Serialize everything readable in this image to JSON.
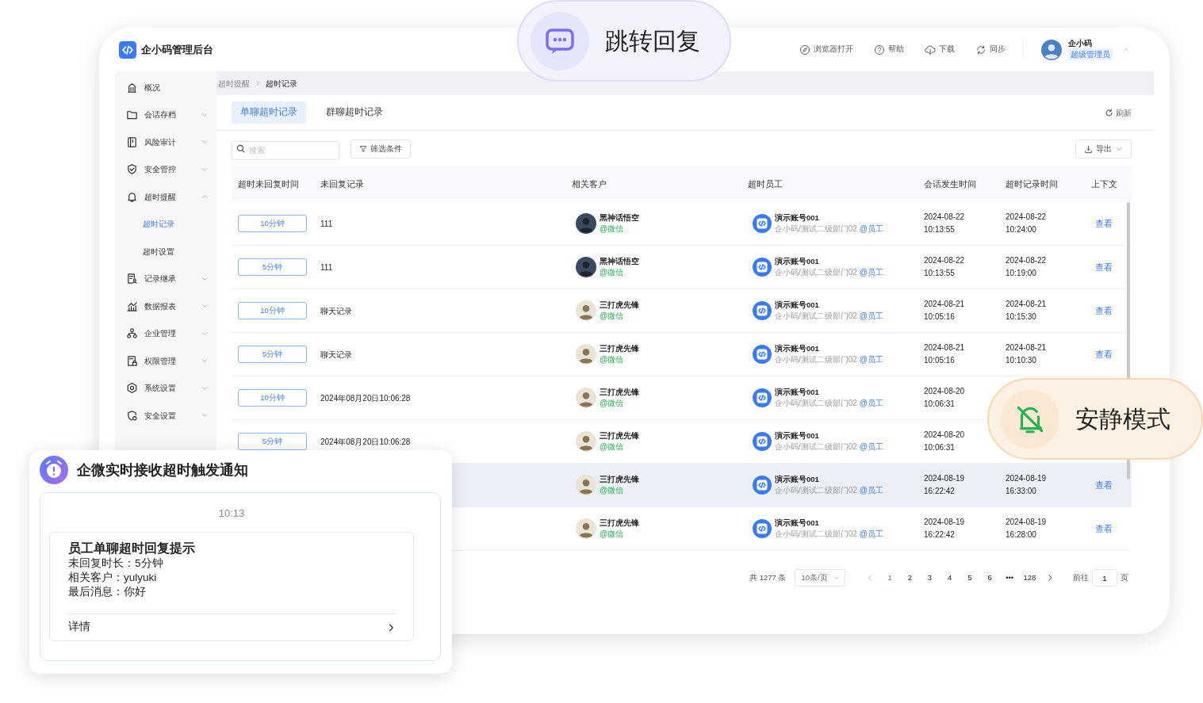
{
  "callouts": [
    {
      "kind": "jump",
      "label": "跳转回复"
    },
    {
      "kind": "quiet",
      "label": "安静模式"
    }
  ],
  "app": {
    "title": "企小码管理后台",
    "toolbar": [
      {
        "label": "浏览器打开"
      },
      {
        "label": "帮助"
      },
      {
        "label": "下载"
      },
      {
        "label": "同步"
      }
    ],
    "user": {
      "name": "企小码",
      "role": "超级管理员"
    }
  },
  "sidebar": {
    "items": [
      {
        "label": "概况",
        "selected": false
      },
      {
        "label": "会话存档",
        "expanded": false,
        "selected": false
      },
      {
        "label": "风险审计",
        "expanded": false,
        "selected": false
      },
      {
        "label": "安全管控",
        "expanded": false,
        "selected": false
      },
      {
        "label": "超时提醒",
        "expanded": true,
        "selected": false,
        "children": [
          {
            "label": "超时记录",
            "selected": true
          },
          {
            "label": "超时设置",
            "selected": false
          }
        ]
      },
      {
        "label": "记录继承",
        "expanded": false,
        "selected": false
      },
      {
        "label": "数据报表",
        "expanded": false,
        "selected": false
      },
      {
        "label": "企业管理",
        "expanded": false,
        "selected": false
      },
      {
        "label": "权限管理",
        "expanded": false,
        "selected": false
      },
      {
        "label": "系统设置",
        "expanded": false,
        "selected": false
      },
      {
        "label": "安全设置",
        "expanded": false,
        "selected": false
      }
    ]
  },
  "breadcrumbs": [
    "超时提醒",
    "超时记录"
  ],
  "tabs": [
    {
      "label": "单聊超时记录",
      "selected": true
    },
    {
      "label": "群聊超时记录",
      "selected": false
    }
  ],
  "refresh": "刷新",
  "search": {
    "placeholder": "搜索"
  },
  "filter": "筛选条件",
  "export": "导出",
  "table": {
    "columns": [
      "超时未回复时间",
      "未回复记录",
      "相关客户",
      "超时员工",
      "会话发生时间",
      "超时记录时间",
      "上下文"
    ],
    "rows": [
      {
        "timeout": "10分钟",
        "record": "111",
        "customer": "黑神话悟空",
        "customer_source": "@微信",
        "employee": "演示账号001",
        "dept": "企小码/测试二级部门02",
        "employee_tag": "@员工",
        "session_date": "2024-08-22",
        "session_time": "10:13:55",
        "record_date": "2024-08-22",
        "record_time": "10:24:00",
        "action": "查看",
        "highlighted": false
      },
      {
        "timeout": "5分钟",
        "record": "111",
        "customer": "黑神话悟空",
        "customer_source": "@微信",
        "employee": "演示账号001",
        "dept": "企小码/测试二级部门02",
        "employee_tag": "@员工",
        "session_date": "2024-08-22",
        "session_time": "10:13:55",
        "record_date": "2024-08-22",
        "record_time": "10:19:00",
        "action": "查看",
        "highlighted": false
      },
      {
        "timeout": "10分钟",
        "record": "聊天记录",
        "customer": "三打虎先锋",
        "customer_source": "@微信",
        "employee": "演示账号001",
        "dept": "企小码/测试二级部门02",
        "employee_tag": "@员工",
        "session_date": "2024-08-21",
        "session_time": "10:05:16",
        "record_date": "2024-08-21",
        "record_time": "10:15:30",
        "action": "查看",
        "highlighted": false
      },
      {
        "timeout": "5分钟",
        "record": "聊天记录",
        "customer": "三打虎先锋",
        "customer_source": "@微信",
        "employee": "演示账号001",
        "dept": "企小码/测试二级部门02",
        "employee_tag": "@员工",
        "session_date": "2024-08-21",
        "session_time": "10:05:16",
        "record_date": "2024-08-21",
        "record_time": "10:10:30",
        "action": "查看",
        "highlighted": false
      },
      {
        "timeout": "10分钟",
        "record": "2024年08月20日10:06:28",
        "customer": "三打虎先锋",
        "customer_source": "@微信",
        "employee": "演示账号001",
        "dept": "企小码/测试二级部门02",
        "employee_tag": "@员工",
        "session_date": "2024-08-20",
        "session_time": "10:06:31",
        "highlighted": false
      },
      {
        "timeout": "5分钟",
        "record": "2024年08月20日10:06:28",
        "customer": "三打虎先锋",
        "customer_source": "@微信",
        "employee": "演示账号001",
        "dept": "企小码/测试二级部门02",
        "employee_tag": "@员工",
        "session_date": "2024-08-20",
        "session_time": "10:06:31",
        "highlighted": false
      },
      {
        "customer": "三打虎先锋",
        "customer_source": "@微信",
        "employee": "演示账号001",
        "dept": "企小码/测试二级部门02",
        "employee_tag": "@员工",
        "session_date": "2024-08-19",
        "session_time": "16:22:42",
        "record_date": "2024-08-19",
        "record_time": "16:33:00",
        "action": "查看",
        "highlighted": true
      },
      {
        "customer": "三打虎先锋",
        "customer_source": "@微信",
        "employee": "演示账号001",
        "dept": "企小码/测试二级部门02",
        "employee_tag": "@员工",
        "session_date": "2024-08-19",
        "session_time": "16:22:42",
        "record_date": "2024-08-19",
        "record_time": "16:28:00",
        "action": "查看",
        "highlighted": false
      }
    ]
  },
  "pagination": {
    "total": "共 1277 条",
    "page_size": "10条/页",
    "pages": [
      {
        "label": "1",
        "selected": true
      },
      {
        "label": "2",
        "selected": false
      },
      {
        "label": "3",
        "selected": false
      },
      {
        "label": "4",
        "selected": false
      },
      {
        "label": "5",
        "selected": false
      },
      {
        "label": "6",
        "selected": false
      },
      {
        "label": "•••",
        "selected": false
      },
      {
        "label": "128",
        "selected": false
      }
    ],
    "goto_label": "前往",
    "goto_value": "1",
    "goto_suffix": "页"
  },
  "notification": {
    "title": "企微实时接收超时触发通知",
    "time": "10:13",
    "card": {
      "title": "员工单聊超时回复提示",
      "lines": [
        "未回复时长：5分钟",
        "相关客户：yulyuki",
        "最后消息：你好"
      ],
      "link": "详情"
    }
  }
}
